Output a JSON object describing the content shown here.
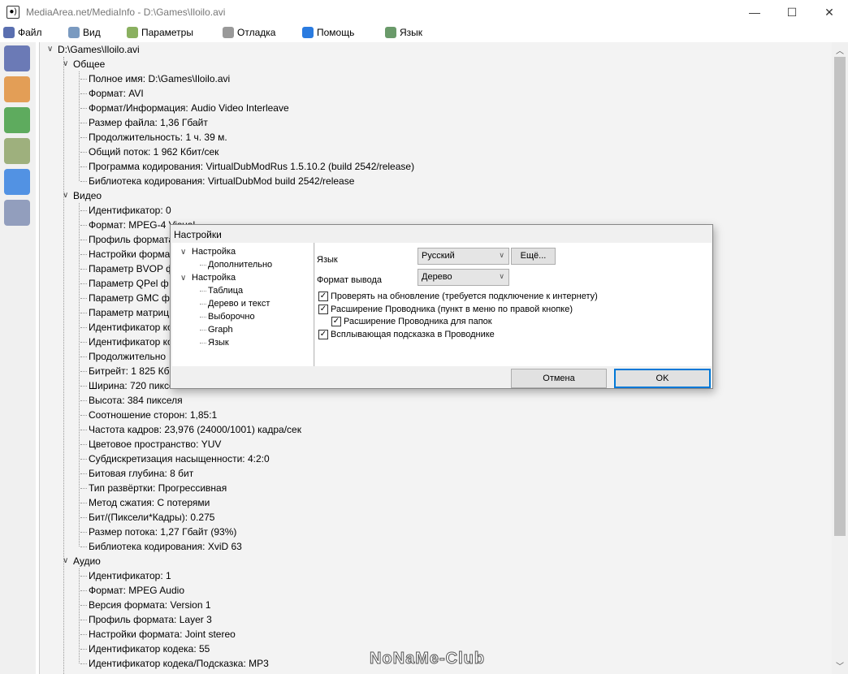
{
  "window": {
    "title": "MediaArea.net/MediaInfo - D:\\Games\\Iloilo.avi",
    "minimize": "—",
    "maximize": "☐",
    "close": "✕"
  },
  "menu": [
    {
      "label": "Файл",
      "icon": "file-menu-icon",
      "color": "#5a6fb0"
    },
    {
      "label": "Вид",
      "icon": "view-menu-icon",
      "color": "#7a9ac0"
    },
    {
      "label": "Параметры",
      "icon": "options-menu-icon",
      "color": "#8ab060"
    },
    {
      "label": "Отладка",
      "icon": "debug-menu-icon",
      "color": "#999"
    },
    {
      "label": "Помощь",
      "icon": "help-menu-icon",
      "color": "#2a7be0"
    },
    {
      "label": "Язык",
      "icon": "language-menu-icon",
      "color": "#6a9a6a"
    }
  ],
  "toolbar": [
    {
      "icon": "open-file-icon",
      "color": "#4a5ca8"
    },
    {
      "icon": "open-folder-icon",
      "color": "#e08a30"
    },
    {
      "icon": "export-icon",
      "color": "#3a9a3a"
    },
    {
      "icon": "preferences-icon",
      "color": "#8aa060"
    },
    {
      "icon": "about-icon",
      "color": "#2a7be0"
    },
    {
      "icon": "tree-view-icon",
      "color": "#7a8ab0"
    }
  ],
  "tree": {
    "root": "D:\\Games\\Iloilo.avi",
    "sections": [
      {
        "title": "Общее",
        "items": [
          "Полное имя: D:\\Games\\Iloilo.avi",
          "Формат: AVI",
          "Формат/Информация: Audio Video Interleave",
          "Размер файла: 1,36 Гбайт",
          "Продолжительность: 1 ч. 39 м.",
          "Общий поток: 1 962 Кбит/сек",
          "Программа кодирования: VirtualDubModRus 1.5.10.2 (build 2542/release)",
          "Библиотека кодирования: VirtualDubMod build 2542/release"
        ]
      },
      {
        "title": "Видео",
        "items": [
          "Идентификатор: 0",
          "Формат: MPEG-4 Visual",
          "Профиль формата",
          "Настройки формата",
          "Параметр BVOP ф",
          "Параметр QPel ф",
          "Параметр GMC ф",
          "Параметр матриц",
          "Идентификатор ко",
          "Идентификатор ко",
          "Продолжительно",
          "Битрейт: 1 825 Кбит/сек",
          "Ширина: 720 пикселей",
          "Высота: 384 пикселя",
          "Соотношение сторон: 1,85:1",
          "Частота кадров: 23,976 (24000/1001) кадра/сек",
          "Цветовое пространство: YUV",
          "Субдискретизация насыщенности: 4:2:0",
          "Битовая глубина: 8 бит",
          "Тип развёртки: Прогрессивная",
          "Метод сжатия: С потерями",
          "Бит/(Пиксели*Кадры): 0.275",
          "Размер потока: 1,27 Гбайт (93%)",
          "Библиотека кодирования: XviD 63"
        ]
      },
      {
        "title": "Аудио",
        "items": [
          "Идентификатор: 1",
          "Формат: MPEG Audio",
          "Версия формата: Version 1",
          "Профиль формата: Layer 3",
          "Настройки формата: Joint stereo",
          "Идентификатор кодека: 55",
          "Идентификатор кодека/Подсказка: MP3"
        ]
      }
    ]
  },
  "watermark": "NoNaMe-Club",
  "dialog": {
    "title": "Настройки",
    "nav": [
      {
        "label": "Настройка",
        "children": [
          "Дополнительно"
        ]
      },
      {
        "label": "Настройка",
        "children": [
          "Таблица",
          "Дерево и текст",
          "Выборочно",
          "Graph",
          "Язык"
        ]
      }
    ],
    "language_label": "Язык",
    "language_value": "Русский",
    "more_button": "Ещё...",
    "output_label": "Формат вывода",
    "output_value": "Дерево",
    "checkboxes": [
      {
        "label": "Проверять на обновление (требуется подключение к интернету)",
        "checked": true
      },
      {
        "label": "Расширение Проводника (пункт в меню по правой кнопке)",
        "checked": true
      },
      {
        "label": "Расширение Проводника для папок",
        "checked": true
      },
      {
        "label": "Всплывающая подсказка в Проводнике",
        "checked": true
      }
    ],
    "cancel": "Отмена",
    "ok": "OK"
  }
}
